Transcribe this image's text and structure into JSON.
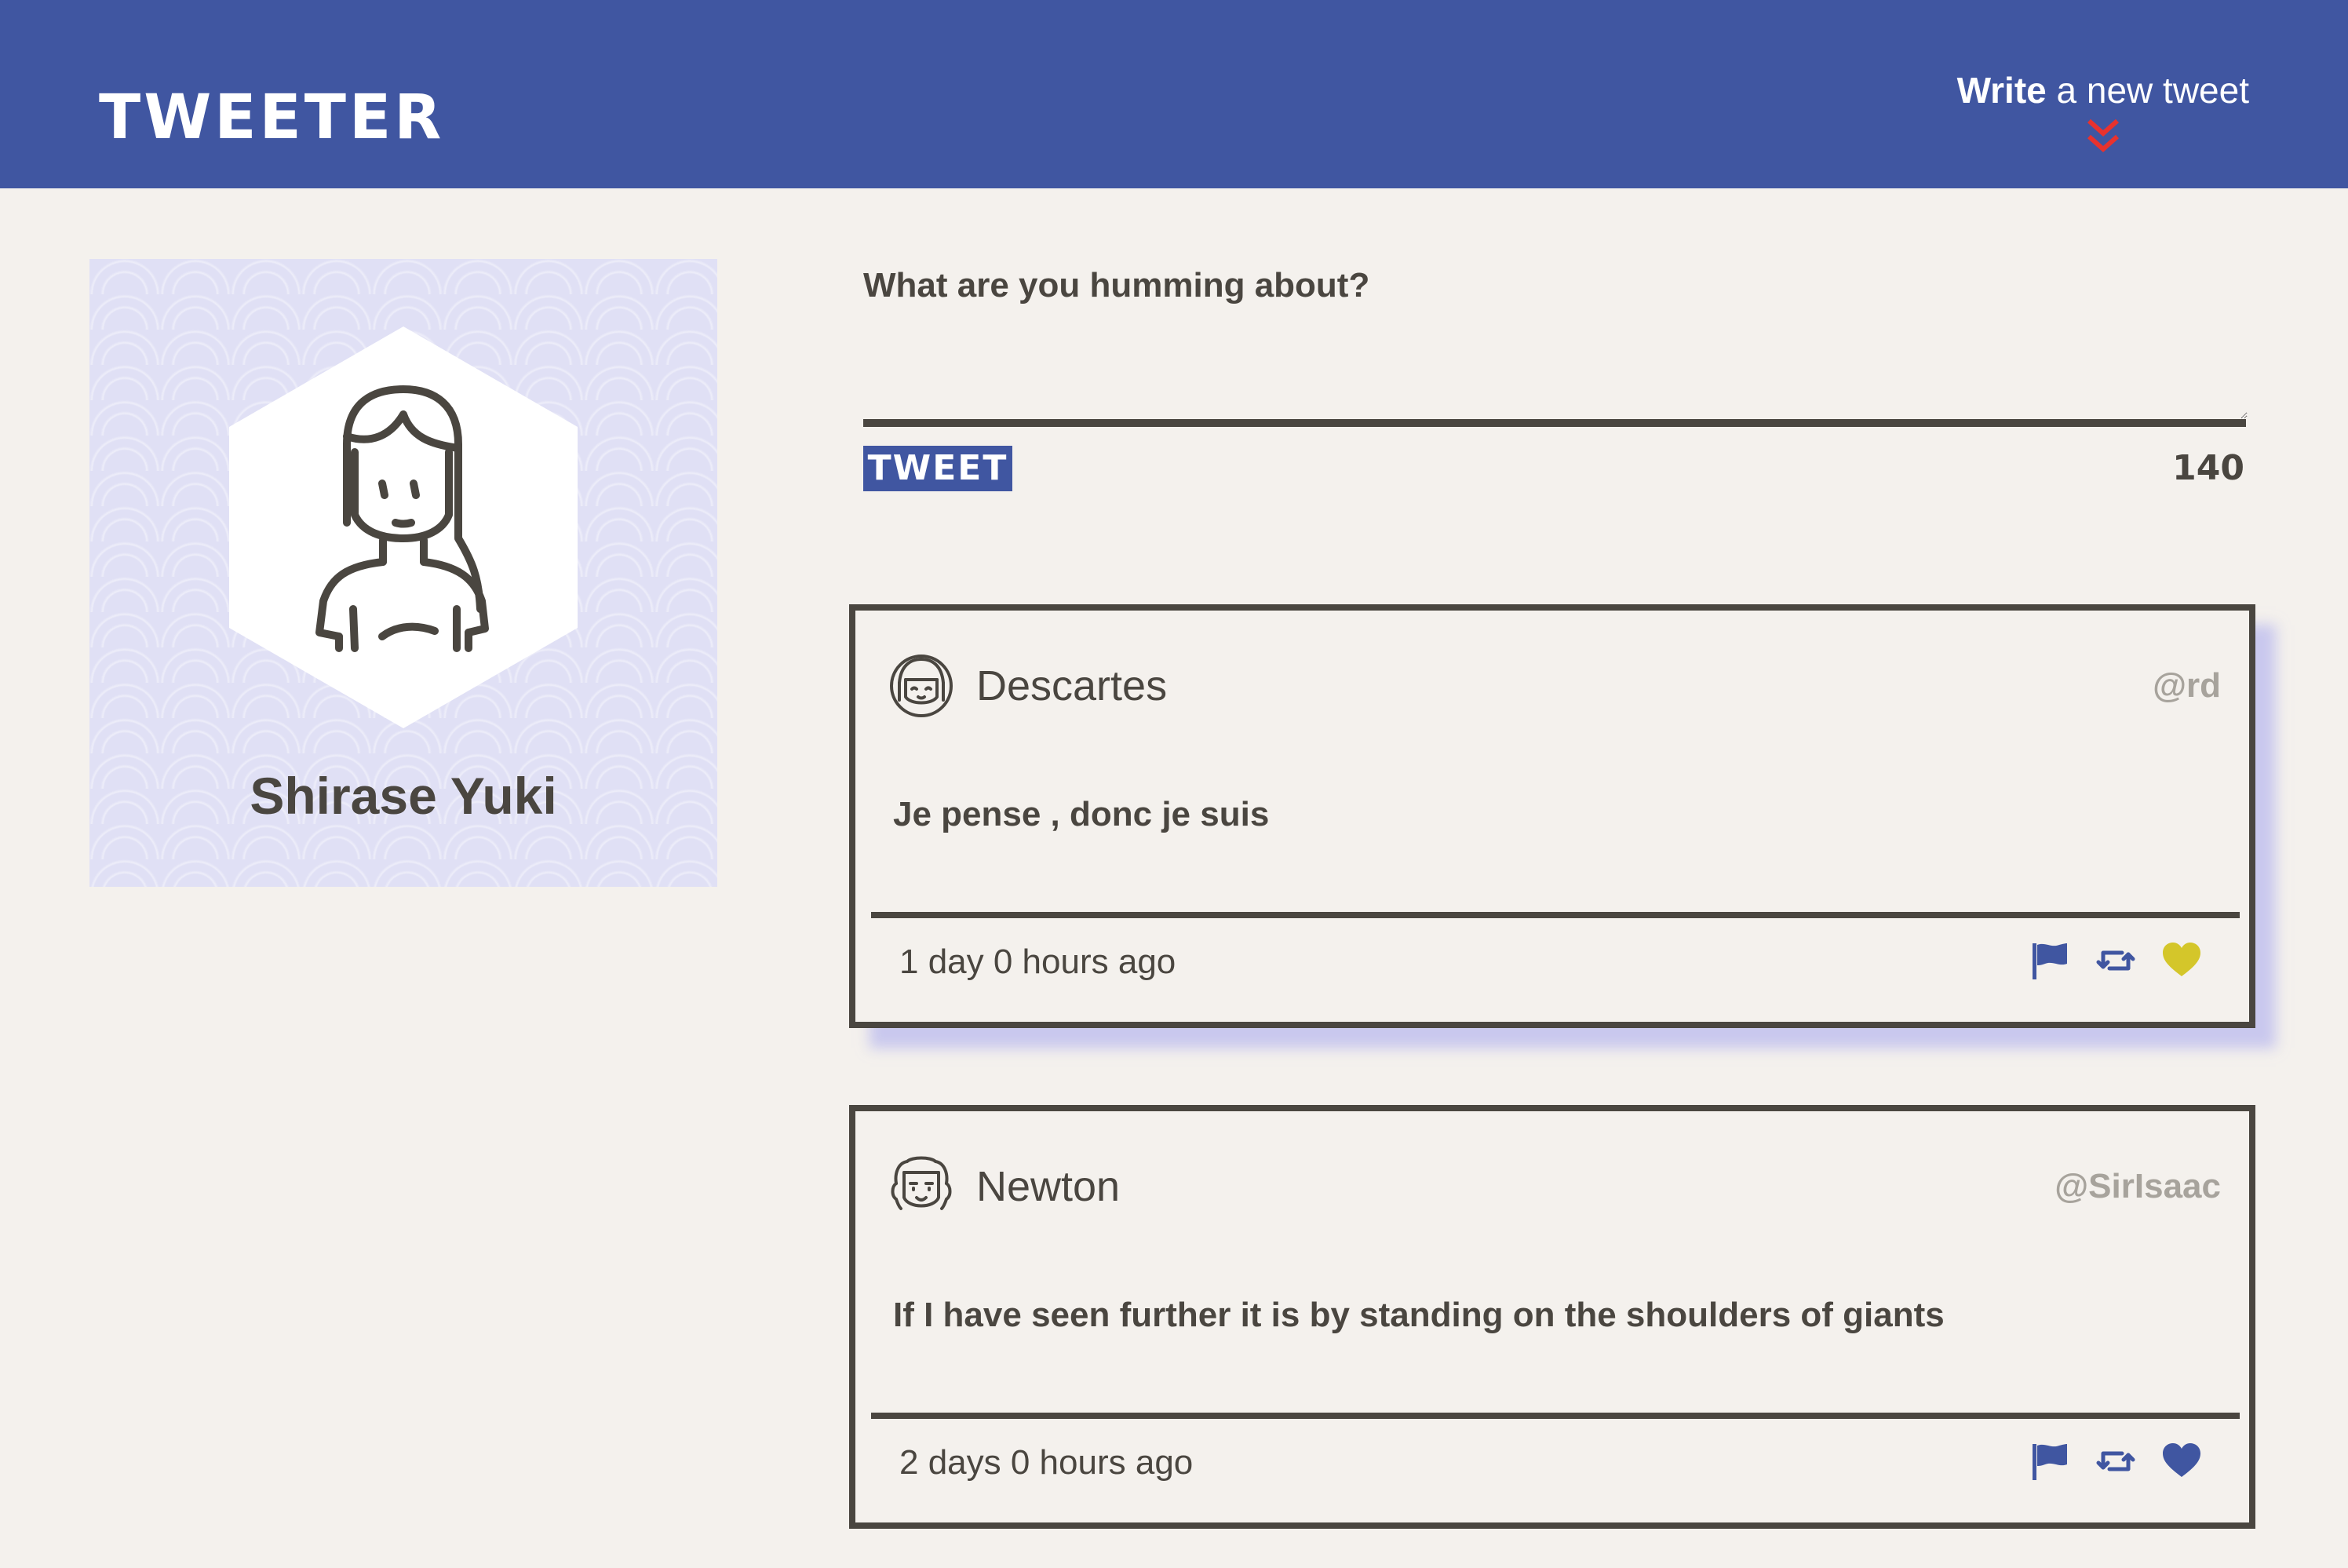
{
  "header": {
    "brand": "TWEETER",
    "compose_bold": "Write",
    "compose_rest": " a new tweet"
  },
  "profile": {
    "name": "Shirase Yuki"
  },
  "composer": {
    "label": "What are you humming about?",
    "input_value": "",
    "submit_label": "TWEET",
    "counter": "140"
  },
  "tweets": [
    {
      "name": "Descartes",
      "handle": "@rd",
      "text": "Je pense , donc je suis",
      "time": "1 day 0 hours ago",
      "liked": true
    },
    {
      "name": "Newton",
      "handle": "@SirIsaac",
      "text": "If I have seen further it is by standing on the shoulders of giants",
      "time": "2 days 0 hours ago",
      "liked": false
    }
  ],
  "colors": {
    "navbar": "#4056a1",
    "background": "#f4f1ed",
    "text": "#4a4640",
    "chevron": "#e8322e",
    "action_icon": "#4056a1",
    "liked_heart": "#d4c62a",
    "handle": "#a7a39c"
  },
  "icons": {
    "compose_indicator": "double-chevron-down-icon",
    "flag": "flag-icon",
    "retweet": "retweet-icon",
    "like": "heart-icon"
  }
}
